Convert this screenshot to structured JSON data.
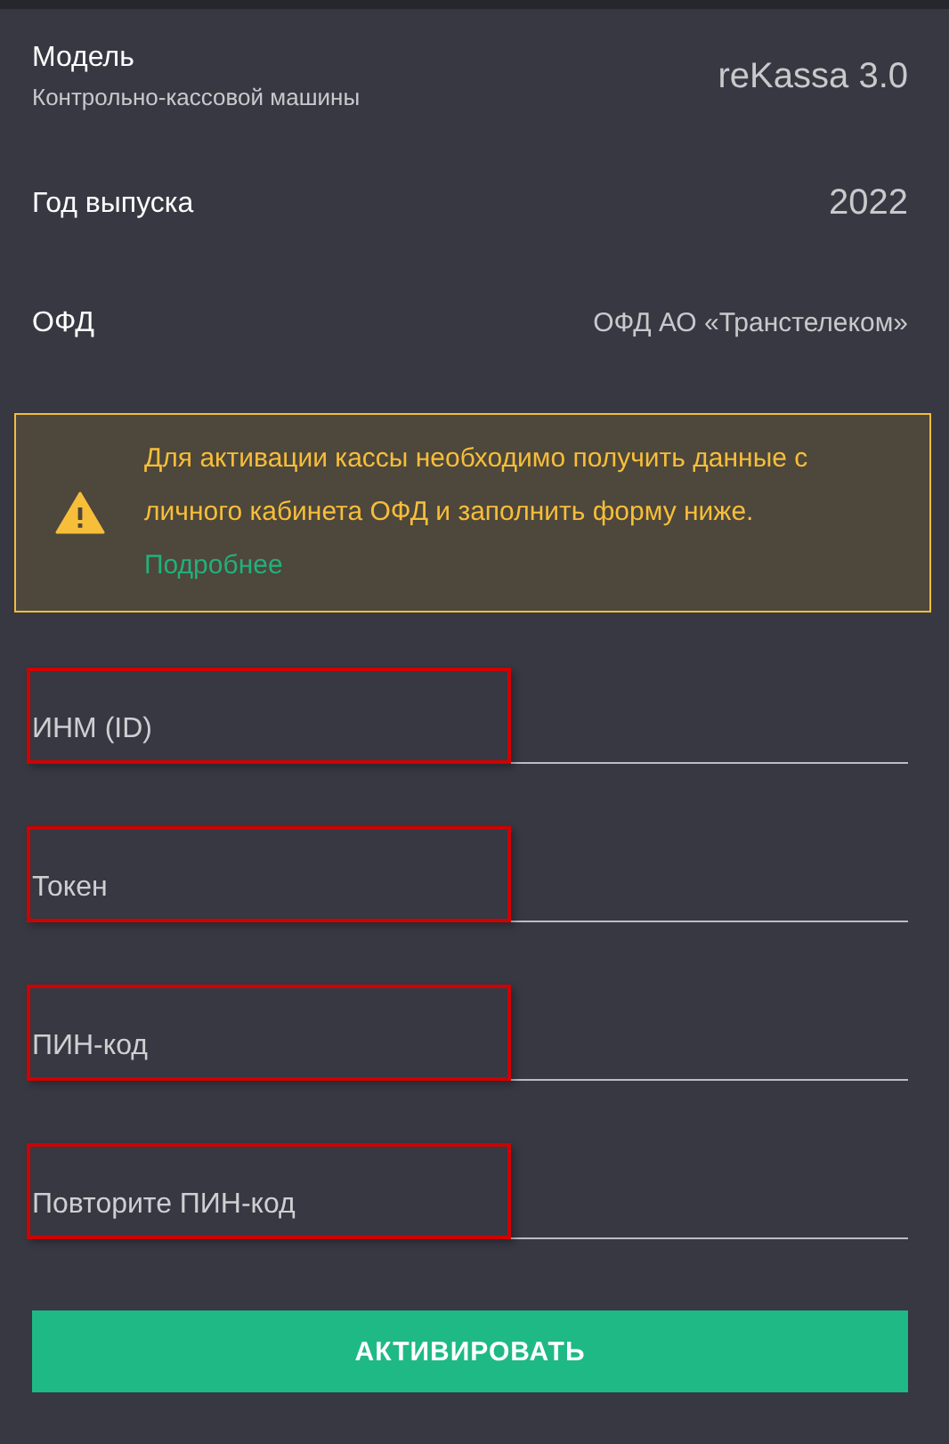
{
  "info_rows": [
    {
      "label": "Модель",
      "sublabel": "Контрольно-кассовой машины",
      "value": "reKassa 3.0"
    },
    {
      "label": "Год выпуска",
      "value": "2022"
    },
    {
      "label": "ОФД",
      "value": "ОФД АО «Транстелеком»",
      "kind": "small"
    }
  ],
  "alert": {
    "text": "Для активации кассы необходимо получить данные с личного кабинета ОФД и заполнить форму ниже.",
    "link": "Подробнее"
  },
  "fields": [
    {
      "placeholder": "ИНМ (ID)",
      "highlighted": true
    },
    {
      "placeholder": "Токен",
      "highlighted": true
    },
    {
      "placeholder": "ПИН-код",
      "highlighted": true
    },
    {
      "placeholder": "Повторите ПИН-код",
      "highlighted": true
    }
  ],
  "button": "АКТИВИРОВАТЬ"
}
